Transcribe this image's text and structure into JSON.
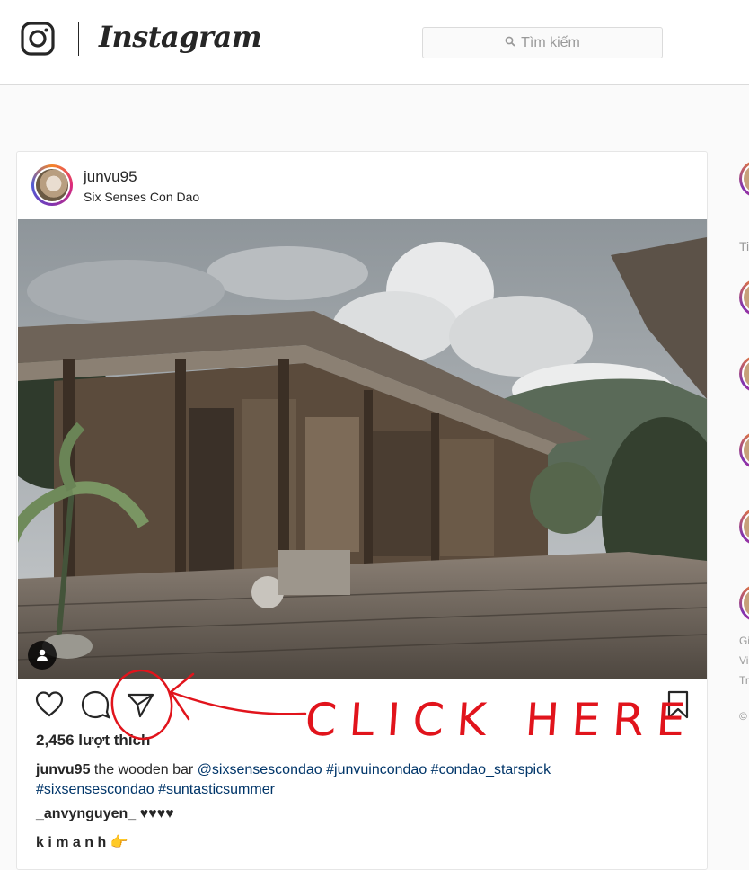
{
  "header": {
    "brand": "Instagram",
    "search_placeholder": "Tìm kiếm"
  },
  "post": {
    "username": "junvu95",
    "location": "Six Senses Con Dao",
    "likes": "2,456 lượt thích",
    "caption": {
      "username": "junvu95",
      "text": "the wooden bar",
      "mention": "@sixsensescondao",
      "tags_line1": [
        "#junvuincondao",
        "#condao_starspick"
      ],
      "tags_line2": [
        "#sixsensescondao",
        "#suntasticsummer"
      ]
    },
    "comments": [
      {
        "username": "_anvynguyen_",
        "text": "♥♥♥♥"
      },
      {
        "username": "k i m a n h",
        "text": "👉"
      }
    ]
  },
  "annotation": {
    "text": "CLICK HERE",
    "color": "#e1141c"
  },
  "sidebar": {
    "title_fragment": "Ti",
    "footer_fragments": [
      "Gi",
      "Vi",
      "Tr",
      "©"
    ]
  },
  "icons": {
    "logo": "instagram-logo-icon",
    "search": "search-icon",
    "like": "heart-icon",
    "comment": "comment-icon",
    "share": "share-paper-plane-icon",
    "save": "bookmark-icon",
    "tagged": "user-tag-icon"
  }
}
